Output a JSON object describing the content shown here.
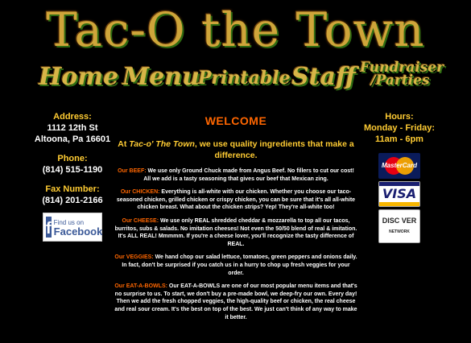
{
  "header": {
    "title": "Tac-O the Town"
  },
  "nav": {
    "home": "Home",
    "menu": "Menu",
    "printable": "Printable",
    "staff": "Staff",
    "fundraiser_line1": "Fundraiser",
    "fundraiser_line2": "/Parties"
  },
  "contact": {
    "address_label": "Address:",
    "address_line1": "1112 12th St",
    "address_line2": "Altoona, Pa 16601",
    "phone_label": "Phone:",
    "phone": "(814) 515-1190",
    "fax_label": "Fax Number:",
    "fax": "(814) 201-2166",
    "facebook_small": "Find us on",
    "facebook_big": "Facebook"
  },
  "hours": {
    "label": "Hours:",
    "days": "Monday - Friday:",
    "time": "11am - 6pm"
  },
  "payment": {
    "mastercard": "MasterCard",
    "visa": "VISA",
    "discover": "DISC VER",
    "discover_sub": "NETWORK"
  },
  "main": {
    "welcome": "WELCOME",
    "intro_prefix": "At ",
    "intro_name": "Tac-o' The Town",
    "intro_suffix": ", we use quality ingredients that make a difference.",
    "sections": [
      {
        "label": "Our BEEF:",
        "text": " We use only Ground Chuck made from Angus Beef. No fillers to cut our cost! All we add is a tasty seasoning that gives our beef that Mexican zing."
      },
      {
        "label": "Our CHICKEN:",
        "text": " Everything is all-white with our chicken. Whether you choose our taco-seasoned chicken, grilled chicken or crispy chicken, you can be sure that it's all all-white chicken breast. What about the chicken strips? Yep! They're all-white too!"
      },
      {
        "label": "Our CHEESE:",
        "text": " We use only REAL shredded cheddar & mozzarella to top all our tacos, burritos, subs & salads. No imitation cheeses! Not even the 50/50 blend of real & imitation. It's ALL REAL! Mmmmm. If you're a cheese lover, you'll recognize the tasty difference of REAL."
      },
      {
        "label": "Our VEGGIES:",
        "text": " We hand chop our salad lettuce, tomatoes, green peppers and onions daily. In fact, don't be surprised if you catch us in a hurry to chop up fresh veggies for your order."
      },
      {
        "label": "Our EAT-A-BOWLS:",
        "text": " Our EAT-A-BOWLS are one of our most popular menu items and that's no surprise to us. To start, we don't buy a pre-made bowl, we deep-fry our own. Every day! Then we add the fresh chopped veggies, the high-quality beef or chicken, the real cheese and real sour cream. It's the best on top of the best. We just can't think of any way to make it better."
      }
    ]
  }
}
